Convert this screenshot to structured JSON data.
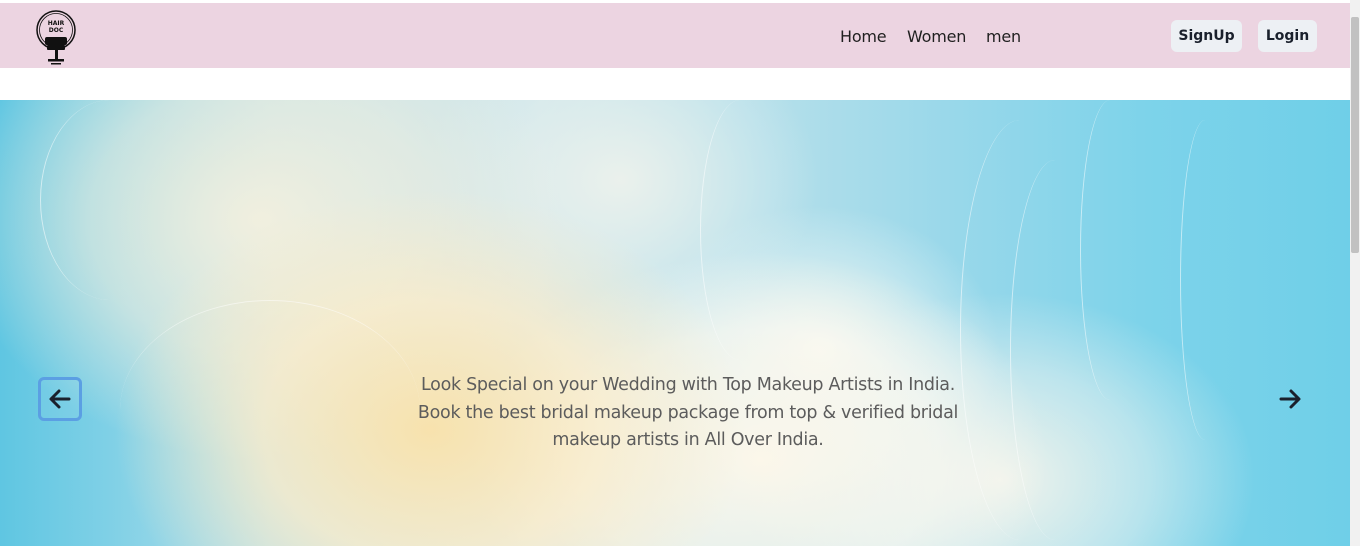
{
  "brand": {
    "logo_text_line1": "HAIR",
    "logo_text_line2": "DOC"
  },
  "nav": {
    "links": [
      "Home",
      "Women",
      "men"
    ]
  },
  "auth": {
    "signup_label": "SignUp",
    "login_label": "Login"
  },
  "hero": {
    "caption": "Look Special on your Wedding with Top Makeup Artists in India. Book the best bridal makeup package from top & verified bridal makeup artists in All Over India."
  },
  "icons": {
    "prev": "arrow-left-icon",
    "next": "arrow-right-icon"
  },
  "colors": {
    "navbar_bg": "#ecd4e1",
    "button_bg": "#edf0f4",
    "focus_ring": "#5b9fe3"
  }
}
